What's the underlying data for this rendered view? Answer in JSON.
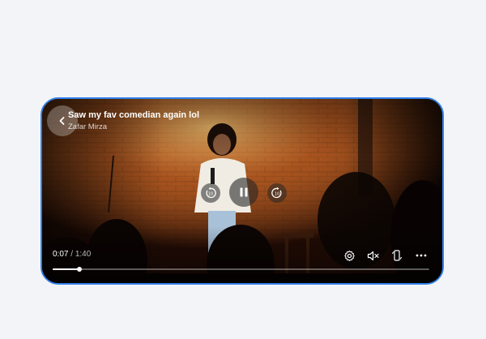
{
  "video": {
    "title": "Saw my fav comedian again lol",
    "author": "Zafar Mirza",
    "current_time": "0:07",
    "separator": " / ",
    "duration": "1:40",
    "progress": 0.07,
    "state": "playing"
  },
  "icons": {
    "back": "chevron-left-icon",
    "rewind": "rewind-10-icon",
    "pause": "pause-icon",
    "forward": "forward-10-icon",
    "settings": "gear-icon",
    "mute": "volume-mute-icon",
    "rotate": "rotate-screen-icon",
    "more": "more-horizontal-icon"
  },
  "colors": {
    "frame_border": "#2f7fe8",
    "page_background": "#f3f4f8"
  }
}
